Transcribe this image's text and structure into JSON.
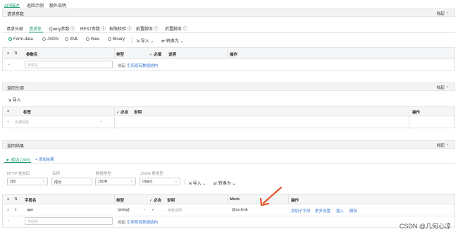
{
  "top_tabs": [
    "API描述",
    "返回示例",
    "额外说明"
  ],
  "request_params": {
    "title": "请求参数",
    "fold_label": "收起",
    "tabs": [
      "请求头部",
      "请求体",
      "Query参数",
      "REST参数",
      "权限校验",
      "前置脚本",
      "后置脚本"
    ],
    "active_tab": "请求体",
    "body_types": [
      "Form-data",
      "JSON",
      "XML",
      "Raw",
      "Binary"
    ],
    "selected_body_type": "Form-data",
    "import_label": "导入",
    "convert_label": "转换为",
    "table_headers": {
      "name": "参数名",
      "type": "类型",
      "required": "必填",
      "desc": "说明",
      "ops": "操作"
    },
    "name_placeholder": "参数名",
    "fold_row": "收起",
    "ref_link": "引用现有数据结构"
  },
  "response_headers": {
    "title": "返回头部",
    "fold_label": "收起",
    "import_label": "导入",
    "table_headers": {
      "label": "标签",
      "required": "必含",
      "desc": "说明",
      "ops": "操作"
    },
    "name_placeholder": "头部标签"
  },
  "response_result": {
    "title": "返回结果",
    "fold_label": "收起",
    "result_tab": "成功 (200)",
    "add_result": "+ 添加结果",
    "meta_labels": [
      "HTTP 状态码",
      "名称",
      "数据类型",
      "JSON 根类型"
    ],
    "meta_values": {
      "status": "200",
      "name": "成功",
      "data_type": "JSON",
      "root_type": "Object"
    },
    "import_label": "导入",
    "convert_label": "转换为",
    "table_headers": {
      "name": "字段名",
      "type": "类型",
      "required": "必含",
      "desc": "说明",
      "mock": "Mock",
      "ops": "操作"
    },
    "row": {
      "name": "age",
      "type": "[string]",
      "desc_placeholder": "参数说明",
      "mock": "@so.limit",
      "ops": [
        "添加子字段",
        "更多设置",
        "插入",
        "删除"
      ]
    },
    "name_placeholder": "字段名",
    "fold_row": "收起",
    "ref_link": "引用现有数据结构"
  },
  "watermark": "CSDN @几何心凉",
  "colors": {
    "accent": "#1f9d7a",
    "link": "#3a7bd5",
    "arrow": "#e0542a"
  }
}
